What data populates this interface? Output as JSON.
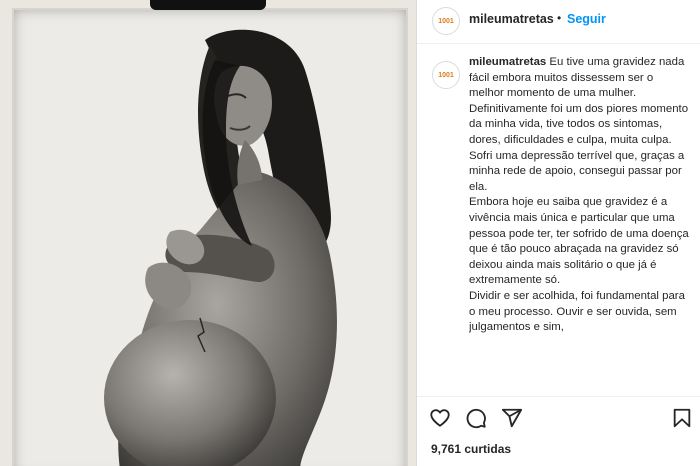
{
  "post": {
    "username": "mileumatretas",
    "separator": "•",
    "follow_label": "Seguir",
    "avatar_text": "1001",
    "caption_lines": [
      "Eu tive uma gravidez nada fácil embora muitos dissessem ser o melhor momento de uma mulher.",
      "Definitivamente foi um dos piores momento da minha vida, tive todos os sintomas, dores, dificuldades e culpa, muita culpa.",
      "Sofri uma depressão terrível que, graças a minha rede de apoio, consegui passar por ela.",
      "Embora hoje eu saiba que gravidez é a vivência mais única e particular que uma pessoa pode ter, ter sofrido de uma doença que é tão pouco abraçada na gravidez só deixou ainda mais solitário o que já é extremamente só.",
      "Dividir e ser acolhida, foi fundamental para o meu processo. Ouvir e ser ouvida, sem julgamentos e sim,"
    ],
    "likes_text": "9,761 curtidas"
  },
  "icons": {
    "like": "heart-icon",
    "comment": "comment-icon",
    "share": "share-icon",
    "save": "bookmark-icon"
  },
  "colors": {
    "link_blue": "#0095f6",
    "text": "#262626",
    "border": "#dbdbdb"
  }
}
